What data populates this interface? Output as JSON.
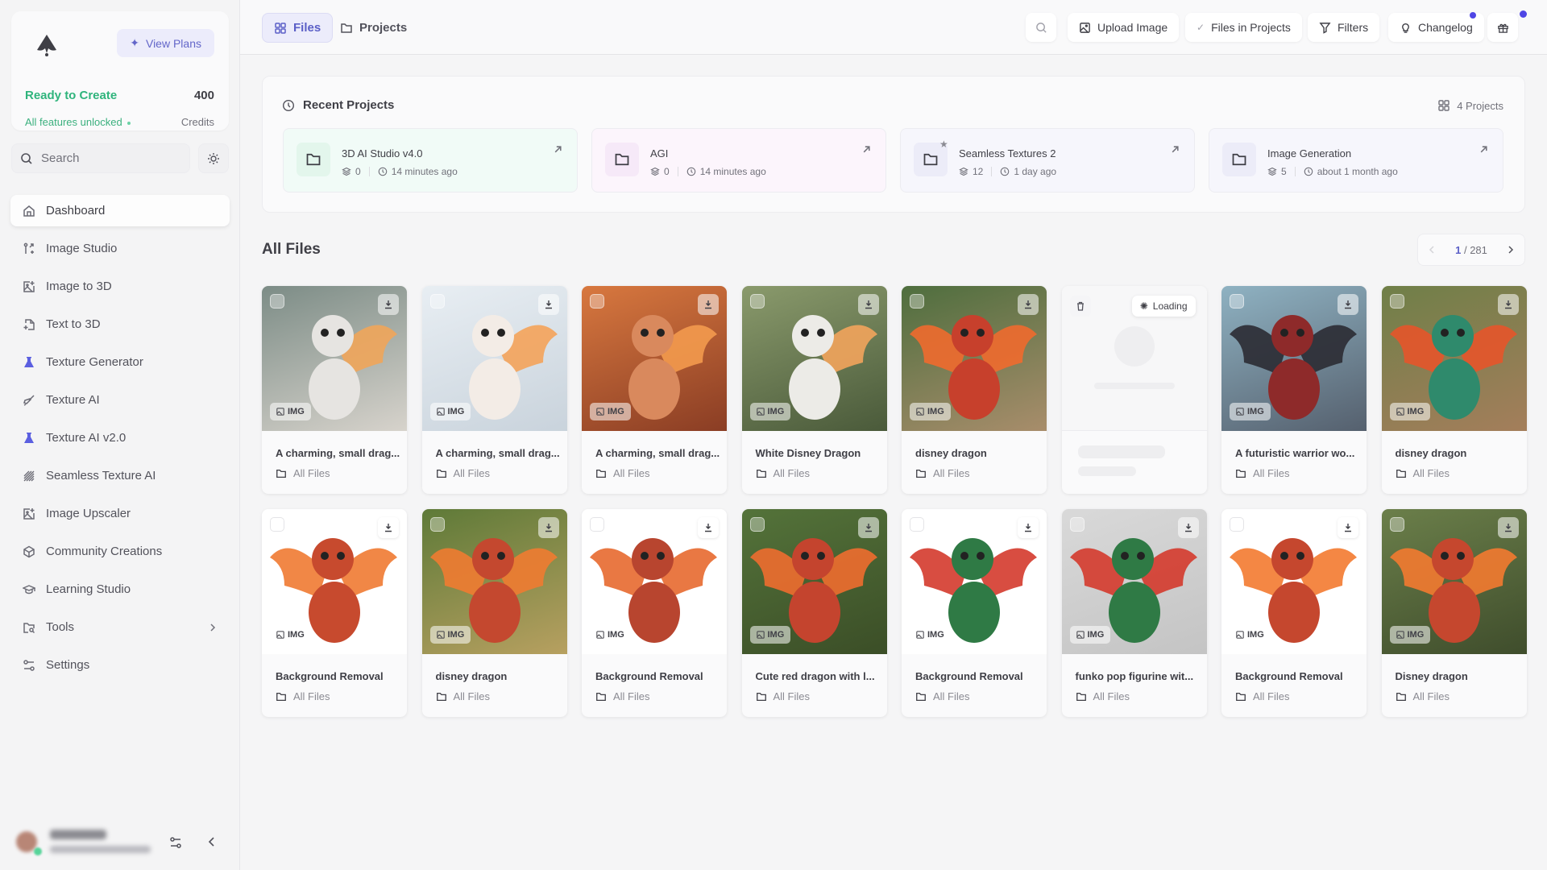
{
  "sidebar": {
    "view_plans": "View Plans",
    "status_title": "Ready to Create",
    "status_sub": "All features unlocked",
    "credits_value": "400",
    "credits_label": "Credits",
    "search_placeholder": "Search",
    "items": [
      {
        "label": "Dashboard",
        "icon": "home-icon"
      },
      {
        "label": "Image Studio",
        "icon": "git-compare-icon"
      },
      {
        "label": "Image to 3D",
        "icon": "image-plus-icon"
      },
      {
        "label": "Text to 3D",
        "icon": "file-plus-icon"
      },
      {
        "label": "Texture Generator",
        "icon": "flask-icon"
      },
      {
        "label": "Texture AI",
        "icon": "paintbrush-icon"
      },
      {
        "label": "Texture AI v2.0",
        "icon": "flask-icon"
      },
      {
        "label": "Seamless Texture AI",
        "icon": "hatch-icon"
      },
      {
        "label": "Image Upscaler",
        "icon": "image-plus-icon"
      },
      {
        "label": "Community Creations",
        "icon": "box-icon"
      },
      {
        "label": "Learning Studio",
        "icon": "graduation-cap-icon"
      },
      {
        "label": "Tools",
        "icon": "folder-search-icon"
      },
      {
        "label": "Settings",
        "icon": "sliders-icon"
      }
    ]
  },
  "topbar": {
    "tabs": [
      {
        "label": "Files"
      },
      {
        "label": "Projects"
      }
    ],
    "upload": "Upload Image",
    "files_in_projects": "Files in Projects",
    "filters": "Filters",
    "changelog": "Changelog"
  },
  "recent": {
    "title": "Recent Projects",
    "count": "4 Projects",
    "projects": [
      {
        "name": "3D AI Studio v4.0",
        "files": "0",
        "time": "14 minutes ago",
        "tint": "#f1fbf7",
        "icon_bg": "#e3f6ec",
        "starred": false
      },
      {
        "name": "AGI",
        "files": "0",
        "time": "14 minutes ago",
        "tint": "#fcf5fc",
        "icon_bg": "#f6e9f8",
        "starred": false
      },
      {
        "name": "Seamless Textures 2",
        "files": "12",
        "time": "1 day ago",
        "tint": "#f6f6fc",
        "icon_bg": "#ececf8",
        "starred": true
      },
      {
        "name": "Image Generation",
        "files": "5",
        "time": "about 1 month ago",
        "tint": "#f6f6fc",
        "icon_bg": "#ececf8",
        "starred": false
      }
    ]
  },
  "files": {
    "title": "All Files",
    "page_current": "1",
    "page_total": "/ 281",
    "badge": "IMG",
    "loading": "Loading",
    "items": [
      {
        "title": "A charming, small drag...",
        "folder": "All Files",
        "bg": [
          "#7c8c86",
          "#d7d3cc"
        ],
        "subject": "#e6e4e1",
        "wing": "#f0a55a"
      },
      {
        "title": "A charming, small drag...",
        "folder": "All Files",
        "bg": [
          "#e8eef3",
          "#c9d3dc"
        ],
        "subject": "#f3ece6",
        "wing": "#f4a35a"
      },
      {
        "title": "A charming, small drag...",
        "folder": "All Files",
        "bg": [
          "#d8783f",
          "#8a3d24"
        ],
        "subject": "#d9895d",
        "wing": "#f39a4e"
      },
      {
        "title": "White Disney Dragon",
        "folder": "All Files",
        "bg": [
          "#8a9a6c",
          "#4a5a3a"
        ],
        "subject": "#ecebe7",
        "wing": "#f2a45c"
      },
      {
        "title": "disney dragon",
        "folder": "All Files",
        "bg": [
          "#4e6e3e",
          "#a88d6b"
        ],
        "subject": "#c7402c",
        "wing": "#ef6a2e"
      },
      {
        "title": "",
        "folder": "",
        "loading": true
      },
      {
        "title": "A futuristic warrior wo...",
        "folder": "All Files",
        "bg": [
          "#8fb2c2",
          "#55606e"
        ],
        "subject": "#8e2a2a",
        "wing": "#2b2b33"
      },
      {
        "title": "disney dragon",
        "folder": "All Files",
        "bg": [
          "#6f7f48",
          "#a47e5b"
        ],
        "subject": "#2f8a6c",
        "wing": "#e5552a"
      },
      {
        "title": "Background Removal",
        "folder": "All Files",
        "bg": [
          "#ffffff",
          "#ffffff"
        ],
        "subject": "#c74a2e",
        "wing": "#f07a32"
      },
      {
        "title": "disney dragon",
        "folder": "All Files",
        "bg": [
          "#5e7a38",
          "#b7a060"
        ],
        "subject": "#c4482f",
        "wing": "#ef7b31"
      },
      {
        "title": "Background Removal",
        "folder": "All Files",
        "bg": [
          "#ffffff",
          "#ffffff"
        ],
        "subject": "#b8452f",
        "wing": "#e7692f"
      },
      {
        "title": "Cute red dragon with l...",
        "folder": "All Files",
        "bg": [
          "#54733a",
          "#3b4e27"
        ],
        "subject": "#c4442e",
        "wing": "#ee6d2f"
      },
      {
        "title": "Background Removal",
        "folder": "All Files",
        "bg": [
          "#ffffff",
          "#ffffff"
        ],
        "subject": "#2f7a45",
        "wing": "#d43a2c"
      },
      {
        "title": "funko pop figurine wit...",
        "folder": "All Files",
        "bg": [
          "#d9d9d9",
          "#c4c4c4"
        ],
        "subject": "#2f7a45",
        "wing": "#d43a2c"
      },
      {
        "title": "Background Removal",
        "folder": "All Files",
        "bg": [
          "#ffffff",
          "#ffffff"
        ],
        "subject": "#c5472e",
        "wing": "#f37a30"
      },
      {
        "title": "Disney dragon",
        "folder": "All Files",
        "bg": [
          "#6b7f4a",
          "#3f4d2c"
        ],
        "subject": "#c5472e",
        "wing": "#f37a30"
      }
    ]
  }
}
